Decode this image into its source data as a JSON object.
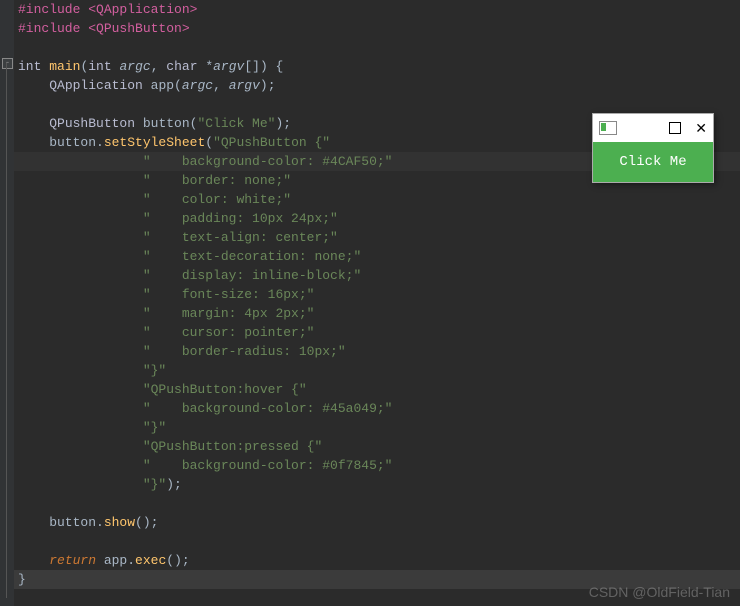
{
  "code": {
    "inc1_pp": "#include",
    "inc1_path": " <QApplication>",
    "inc2_pp": "#include",
    "inc2_path": " <QPushButton>",
    "sig_ty1": "int ",
    "sig_fn": "main",
    "sig_open": "(",
    "sig_ty2": "int ",
    "sig_p1": "argc",
    "sig_comma": ", ",
    "sig_ty3": "char ",
    "sig_star": "*",
    "sig_p2": "argv",
    "sig_arr": "[]) {",
    "app_ty": "QApplication ",
    "app_var": "app(",
    "app_a1": "argc",
    "app_c": ", ",
    "app_a2": "argv",
    "app_end": ");",
    "btn_ty": "QPushButton ",
    "btn_var": "button(",
    "btn_str": "\"Click Me\"",
    "btn_end": ");",
    "sss_pre": "    button.",
    "sss_fn": "setStyleSheet",
    "sss_open": "(",
    "sss_l0": "\"QPushButton {\"",
    "sss_l1": "\"    background-color: #4CAF50;\"",
    "sss_l2": "\"    border: none;\"",
    "sss_l3": "\"    color: white;\"",
    "sss_l4": "\"    padding: 10px 24px;\"",
    "sss_l5": "\"    text-align: center;\"",
    "sss_l6": "\"    text-decoration: none;\"",
    "sss_l7": "\"    display: inline-block;\"",
    "sss_l8": "\"    font-size: 16px;\"",
    "sss_l9": "\"    margin: 4px 2px;\"",
    "sss_l10": "\"    cursor: pointer;\"",
    "sss_l11": "\"    border-radius: 10px;\"",
    "sss_l12": "\"}\"",
    "sss_l13": "\"QPushButton:hover {\"",
    "sss_l14": "\"    background-color: #45a049;\"",
    "sss_l15": "\"}\"",
    "sss_l16": "\"QPushButton:pressed {\"",
    "sss_l17": "\"    background-color: #0f7845;\"",
    "sss_l18": "\"}\"",
    "sss_close": ");",
    "show_pre": "    button.",
    "show_fn": "show",
    "show_end": "();",
    "ret_kw": "return",
    "ret_sp": " app.",
    "ret_fn": "exec",
    "ret_end": "();",
    "close_brace": "}"
  },
  "popup": {
    "button_label": "Click Me"
  },
  "watermark": "CSDN @OldField-Tian"
}
